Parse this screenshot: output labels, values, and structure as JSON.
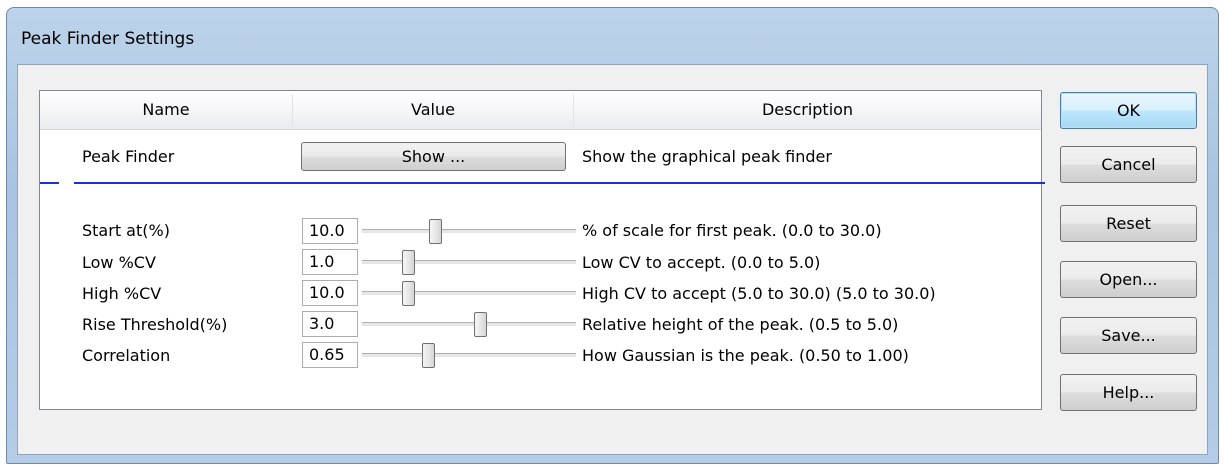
{
  "window": {
    "title": "Peak Finder Settings"
  },
  "grid": {
    "columns": [
      "Name",
      "Value",
      "Description"
    ],
    "peak_finder": {
      "name": "Peak Finder",
      "button_label": "Show ...",
      "description": "Show the graphical peak finder"
    },
    "rows": [
      {
        "name": "Start at(%)",
        "value": "10.0",
        "description": "% of scale for first peak.  (0.0 to 30.0)",
        "level": 0.333
      },
      {
        "name": "Low %CV",
        "value": "1.0",
        "description": "Low CV to accept.  (0.0 to 5.0)",
        "level": 0.2
      },
      {
        "name": "High %CV",
        "value": "10.0",
        "description": "High CV to accept (5.0 to 30.0) (5.0 to 30.0)",
        "level": 0.2
      },
      {
        "name": "Rise Threshold(%)",
        "value": "3.0",
        "description": "Relative height of the peak.   (0.5 to 5.0)",
        "level": 0.556
      },
      {
        "name": "Correlation",
        "value": "0.65",
        "description": "How Gaussian is the peak.  (0.50 to 1.00)",
        "level": 0.3
      }
    ]
  },
  "buttons": {
    "ok": "OK",
    "cancel": "Cancel",
    "reset": "Reset",
    "open": "Open...",
    "save": "Save...",
    "help": "Help..."
  }
}
